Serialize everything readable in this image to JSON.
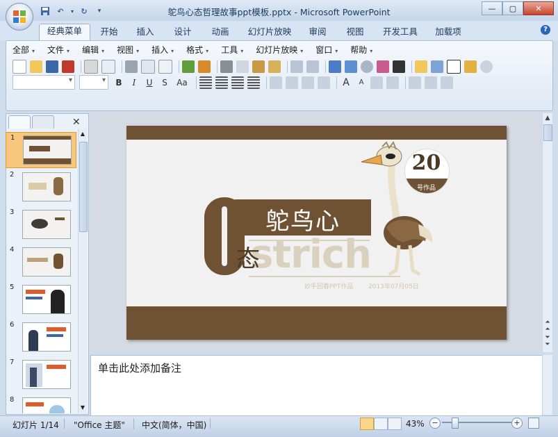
{
  "window": {
    "title": "鸵鸟心态哲理故事ppt模板.pptx - Microsoft PowerPoint"
  },
  "ribbon_tabs": [
    {
      "label": "经典菜单",
      "active": true
    },
    {
      "label": "开始"
    },
    {
      "label": "插入"
    },
    {
      "label": "设计"
    },
    {
      "label": "动画"
    },
    {
      "label": "幻灯片放映"
    },
    {
      "label": "审阅"
    },
    {
      "label": "视图"
    },
    {
      "label": "开发工具"
    },
    {
      "label": "加载项"
    }
  ],
  "classic_menu": [
    "全部",
    "文件",
    "编辑",
    "视图",
    "插入",
    "格式",
    "工具",
    "幻灯片放映",
    "窗口",
    "帮助"
  ],
  "slide": {
    "title_cn": "鸵鸟心",
    "title_cn2": "态",
    "title_en": "strich",
    "number": "20",
    "number_sub": "号作品",
    "author": "妙手回春PPT作品",
    "date": "2013年07月05日"
  },
  "slides_panel": {
    "count_shown": 8,
    "selected": 1,
    "numbers": [
      "1",
      "2",
      "3",
      "4",
      "5",
      "6",
      "7",
      "8"
    ]
  },
  "notes": {
    "placeholder": "单击此处添加备注"
  },
  "status": {
    "slide_info": "幻灯片 1/14",
    "theme": "\"Office 主题\"",
    "language": "中文(简体，中国)",
    "zoom": "43%"
  },
  "colors": {
    "brown": "#6f5233",
    "ribbon_blue": "#d7e4f3",
    "selected_thumb": "#f8c77b"
  }
}
